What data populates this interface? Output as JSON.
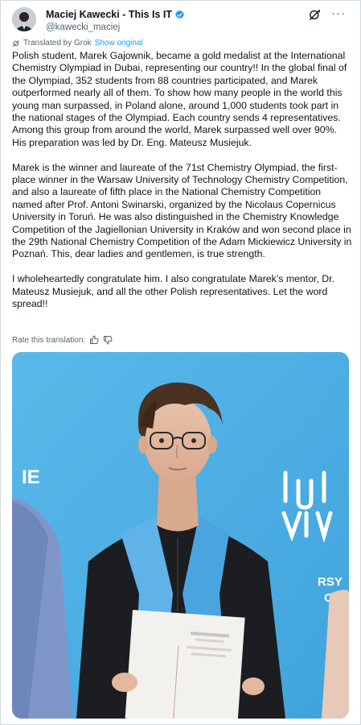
{
  "author": {
    "display_name": "Maciej Kawecki - This Is IT",
    "handle": "@kawecki_maciej",
    "verified": true
  },
  "translation": {
    "label": "Translated by Grok",
    "show_original": "Show original"
  },
  "post": {
    "paragraphs": [
      "Polish student, Marek Gajownik, became a gold medalist at the International Chemistry Olympiad in Dubai, representing our country!! In the global final of the Olympiad, 352 students from 88 countries participated, and Marek outperformed nearly all of them. To show how many people in the world this young man surpassed, in Poland alone, around 1,000 students took part in the national stages of the Olympiad. Each country sends 4 representatives. Among this group from around the world, Marek surpassed well over 90%. His preparation was led by Dr. Eng. Mateusz Musiejuk.",
      "Marek is the winner and laureate of the 71st Chemistry Olympiad, the first-place winner in the Warsaw University of Technology Chemistry Competition, and also a laureate of fifth place in the National Chemistry Competition named after Prof. Antoni Swinarski, organized by the Nicolaus Copernicus University in Toruń. He was also distinguished in the Chemistry Knowledge Competition of the Jagiellonian University in Kraków and won second place in the 29th National Chemistry Competition of the Adam Mickiewicz University in Poznań. This, dear ladies and gentlemen, is true strength.",
      "I wholeheartedly congratulate him. I also congratulate Marek’s mentor, Dr. Mateusz Musiejuk, and all the other Polish representatives. Let the word spread!!"
    ]
  },
  "rate": {
    "label": "Rate this translation:",
    "thumbs_up_icon": "thumbs-up-icon",
    "thumbs_down_icon": "thumbs-down-icon"
  },
  "photo": {
    "backdrop_text_left": "IE",
    "backdrop_text_right_1": "RSY",
    "backdrop_text_right_2": "O-"
  },
  "colors": {
    "accent": "#1d9bf0",
    "secondary_text": "#536471",
    "backdrop_blue": "#4fb0e4"
  }
}
